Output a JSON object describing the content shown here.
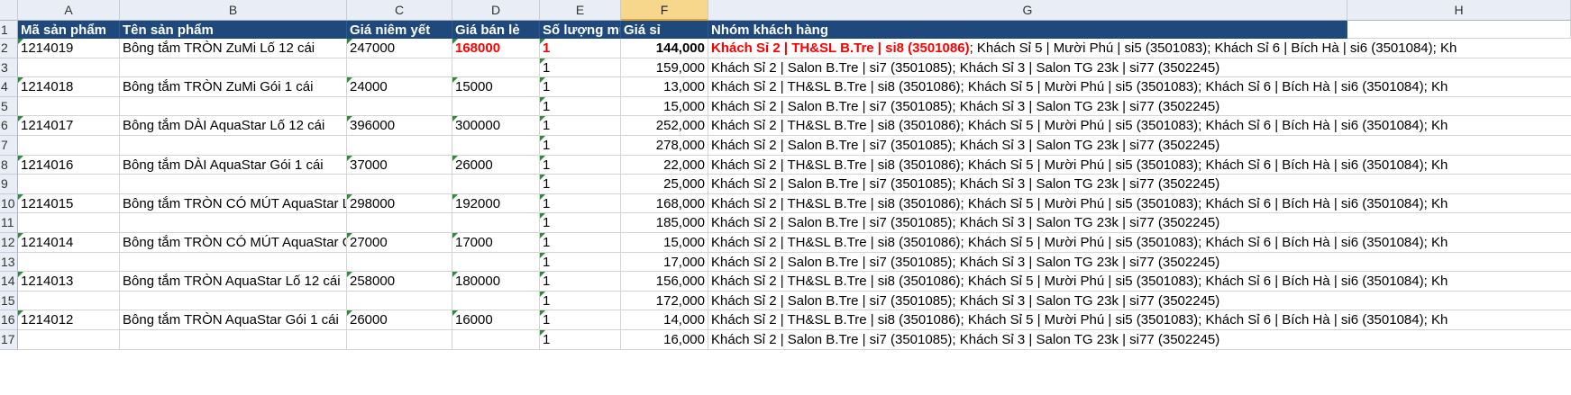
{
  "columns": [
    "A",
    "B",
    "C",
    "D",
    "E",
    "F",
    "G",
    "H"
  ],
  "selected_column": "F",
  "headers": {
    "A": "Mã sản phẩm",
    "B": "Tên sản phẩm",
    "C": "Giá niêm yết",
    "D": "Giá bán lẻ",
    "E": "Số lượng mu",
    "F": "Giá sỉ",
    "G": "Nhóm khách hàng"
  },
  "row_numbers": [
    "1",
    "2",
    "3",
    "4",
    "5",
    "6",
    "7",
    "8",
    "9",
    "10",
    "11",
    "12",
    "13",
    "14",
    "15",
    "16",
    "17"
  ],
  "rows": [
    {
      "A": "1214019",
      "B": "Bông tắm TRÒN ZuMi Lố 12 cái",
      "C": "247000",
      "D": "168000",
      "E": "1",
      "F": "144,000",
      "G_hl": "Khách Sỉ 2 | TH&SL B.Tre | si8 (3501086)",
      "G": "; Khách Sỉ 5 | Mười Phú | si5 (3501083); Khách Sỉ 6 | Bích Hà | si6 (3501084); Kh"
    },
    {
      "A": "",
      "B": "",
      "C": "",
      "D": "",
      "E": "1",
      "F": "159,000",
      "G_hl": "",
      "G": "Khách Sỉ 2 | Salon B.Tre | si7 (3501085); Khách Sỉ 3 | Salon TG 23k | si77 (3502245)"
    },
    {
      "A": "1214018",
      "B": "Bông tắm TRÒN ZuMi Gói 1 cái",
      "C": "24000",
      "D": "15000",
      "E": "1",
      "F": "13,000",
      "G_hl": "",
      "G": "Khách Sỉ 2 | TH&SL B.Tre | si8 (3501086); Khách Sỉ 5 | Mười Phú | si5 (3501083); Khách Sỉ 6 | Bích Hà | si6 (3501084); Kh"
    },
    {
      "A": "",
      "B": "",
      "C": "",
      "D": "",
      "E": "1",
      "F": "15,000",
      "G_hl": "",
      "G": "Khách Sỉ 2 | Salon B.Tre | si7 (3501085); Khách Sỉ 3 | Salon TG 23k | si77 (3502245)"
    },
    {
      "A": "1214017",
      "B": "Bông tắm DÀI AquaStar Lố 12 cái",
      "C": "396000",
      "D": "300000",
      "E": "1",
      "F": "252,000",
      "G_hl": "",
      "G": "Khách Sỉ 2 | TH&SL B.Tre | si8 (3501086); Khách Sỉ 5 | Mười Phú | si5 (3501083); Khách Sỉ 6 | Bích Hà | si6 (3501084); Kh"
    },
    {
      "A": "",
      "B": "",
      "C": "",
      "D": "",
      "E": "1",
      "F": "278,000",
      "G_hl": "",
      "G": "Khách Sỉ 2 | Salon B.Tre | si7 (3501085); Khách Sỉ 3 | Salon TG 23k | si77 (3502245)"
    },
    {
      "A": "1214016",
      "B": "Bông tắm DÀI AquaStar Gói 1 cái",
      "C": "37000",
      "D": "26000",
      "E": "1",
      "F": "22,000",
      "G_hl": "",
      "G": "Khách Sỉ 2 | TH&SL B.Tre | si8 (3501086); Khách Sỉ 5 | Mười Phú | si5 (3501083); Khách Sỉ 6 | Bích Hà | si6 (3501084); Kh"
    },
    {
      "A": "",
      "B": "",
      "C": "",
      "D": "",
      "E": "1",
      "F": "25,000",
      "G_hl": "",
      "G": "Khách Sỉ 2 | Salon B.Tre | si7 (3501085); Khách Sỉ 3 | Salon TG 23k | si77 (3502245)"
    },
    {
      "A": "1214015",
      "B": "Bông tắm TRÒN CÓ MÚT AquaStar Lố",
      "C": "298000",
      "D": "192000",
      "E": "1",
      "F": "168,000",
      "G_hl": "",
      "G": "Khách Sỉ 2 | TH&SL B.Tre | si8 (3501086); Khách Sỉ 5 | Mười Phú | si5 (3501083); Khách Sỉ 6 | Bích Hà | si6 (3501084); Kh"
    },
    {
      "A": "",
      "B": "",
      "C": "",
      "D": "",
      "E": "1",
      "F": "185,000",
      "G_hl": "",
      "G": "Khách Sỉ 2 | Salon B.Tre | si7 (3501085); Khách Sỉ 3 | Salon TG 23k | si77 (3502245)"
    },
    {
      "A": "1214014",
      "B": "Bông tắm TRÒN CÓ MÚT AquaStar Gó",
      "C": "27000",
      "D": "17000",
      "E": "1",
      "F": "15,000",
      "G_hl": "",
      "G": "Khách Sỉ 2 | TH&SL B.Tre | si8 (3501086); Khách Sỉ 5 | Mười Phú | si5 (3501083); Khách Sỉ 6 | Bích Hà | si6 (3501084); Kh"
    },
    {
      "A": "",
      "B": "",
      "C": "",
      "D": "",
      "E": "1",
      "F": "17,000",
      "G_hl": "",
      "G": "Khách Sỉ 2 | Salon B.Tre | si7 (3501085); Khách Sỉ 3 | Salon TG 23k | si77 (3502245)"
    },
    {
      "A": "1214013",
      "B": "Bông tắm TRÒN AquaStar Lố 12 cái",
      "C": "258000",
      "D": "180000",
      "E": "1",
      "F": "156,000",
      "G_hl": "",
      "G": "Khách Sỉ 2 | TH&SL B.Tre | si8 (3501086); Khách Sỉ 5 | Mười Phú | si5 (3501083); Khách Sỉ 6 | Bích Hà | si6 (3501084); Kh"
    },
    {
      "A": "",
      "B": "",
      "C": "",
      "D": "",
      "E": "1",
      "F": "172,000",
      "G_hl": "",
      "G": "Khách Sỉ 2 | Salon B.Tre | si7 (3501085); Khách Sỉ 3 | Salon TG 23k | si77 (3502245)"
    },
    {
      "A": "1214012",
      "B": "Bông tắm TRÒN AquaStar Gói 1 cái",
      "C": "26000",
      "D": "16000",
      "E": "1",
      "F": "14,000",
      "G_hl": "",
      "G": "Khách Sỉ 2 | TH&SL B.Tre | si8 (3501086); Khách Sỉ 5 | Mười Phú | si5 (3501083); Khách Sỉ 6 | Bích Hà | si6 (3501084); Kh"
    },
    {
      "A": "",
      "B": "",
      "C": "",
      "D": "",
      "E": "1",
      "F": "16,000",
      "G_hl": "",
      "G": "Khách Sỉ 2 | Salon B.Tre | si7 (3501085); Khách Sỉ 3 | Salon TG 23k | si77 (3502245)"
    }
  ],
  "colors": {
    "header_fill": "#1f497d",
    "header_text": "#ffffff",
    "highlight_text": "#ff0000",
    "selected_column_header": "#f7d78b",
    "text_indicator": "#2e8b3a"
  }
}
